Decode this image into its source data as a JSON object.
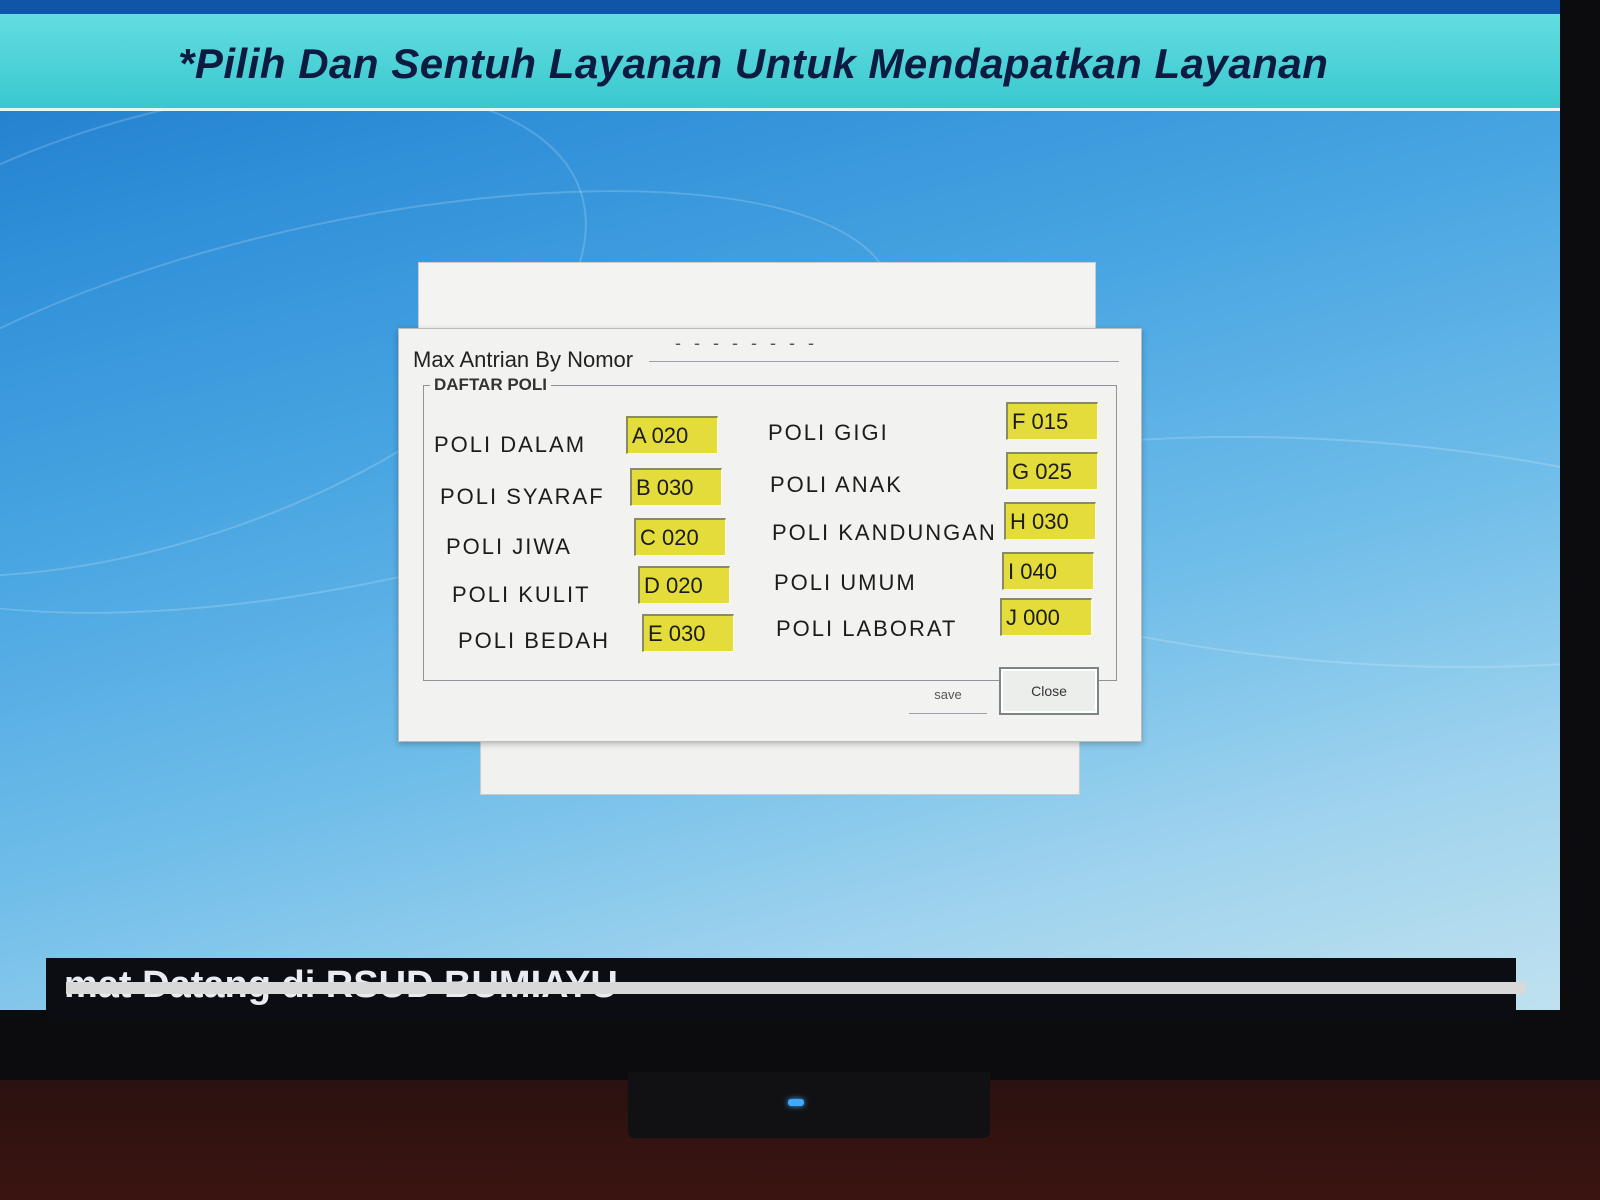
{
  "banner": {
    "text": "*Pilih Dan Sentuh Layanan Untuk Mendapatkan Layanan"
  },
  "dialog": {
    "title": "Max Antrian By Nomor",
    "group_label": "DAFTAR POLI",
    "left_column": [
      {
        "label": "POLI  DALAM",
        "value": "A 020"
      },
      {
        "label": "POLI  SYARAF",
        "value": "B 030"
      },
      {
        "label": "POLI  JIWA",
        "value": "C 020"
      },
      {
        "label": "POLI KULIT",
        "value": "D 020"
      },
      {
        "label": "POLI  BEDAH",
        "value": "E 030"
      }
    ],
    "right_column": [
      {
        "label": "POLI  GIGI",
        "value": "F 015"
      },
      {
        "label": "POLI ANAK",
        "value": "G 025"
      },
      {
        "label": "POLI  KANDUNGAN",
        "value": "H 030"
      },
      {
        "label": "POLI UMUM",
        "value": "I 040"
      },
      {
        "label": "POLI  LABORAT",
        "value": "J 000"
      }
    ],
    "save_label": "save",
    "close_label": "Close"
  },
  "ticker": {
    "text": "mat Datang di RSUD BUMIAYU"
  },
  "colors": {
    "banner_bg": "#39c8cf",
    "field_bg": "#e3dc3a",
    "desktop_bg": "#4aa6e2"
  }
}
